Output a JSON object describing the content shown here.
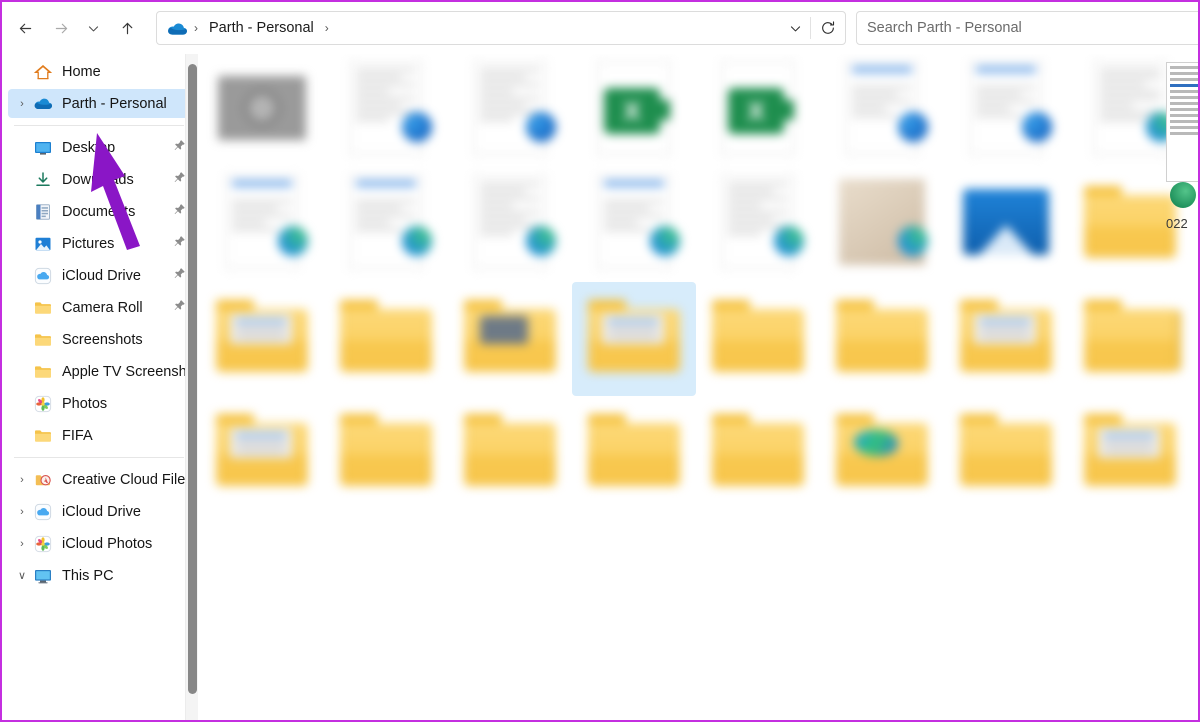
{
  "window": {
    "border_color": "#c42fe0"
  },
  "toolbar": {
    "back_icon": "arrow-left-icon",
    "forward_icon": "arrow-right-icon",
    "recent_icon": "chevron-down-icon",
    "up_icon": "arrow-up-icon",
    "address": {
      "cloud_icon": "onedrive-cloud-icon",
      "crumb_label": "Parth - Personal",
      "sep1": "›",
      "sep2": "›",
      "chevron_icon": "chevron-down-icon"
    },
    "refresh_icon": "refresh-icon",
    "search": {
      "placeholder": "Search Parth - Personal",
      "value": "",
      "icon": "search-icon"
    }
  },
  "sidebar": {
    "items": [
      {
        "label": "Home",
        "icon": "home-icon",
        "chevron": "",
        "pinned": false,
        "selected": false,
        "indent": false
      },
      {
        "label": "Parth - Personal",
        "icon": "onedrive-cloud-icon",
        "chevron": "›",
        "pinned": false,
        "selected": true,
        "indent": false
      },
      {
        "label": "Desktop",
        "icon": "desktop-icon",
        "chevron": "",
        "pinned": true,
        "selected": false,
        "indent": true
      },
      {
        "label": "Downloads",
        "icon": "downloads-icon",
        "chevron": "",
        "pinned": true,
        "selected": false,
        "indent": true
      },
      {
        "label": "Documents",
        "icon": "documents-icon",
        "chevron": "",
        "pinned": true,
        "selected": false,
        "indent": true
      },
      {
        "label": "Pictures",
        "icon": "pictures-icon",
        "chevron": "",
        "pinned": true,
        "selected": false,
        "indent": true
      },
      {
        "label": "iCloud Drive",
        "icon": "icloud-drive-icon",
        "chevron": "",
        "pinned": true,
        "selected": false,
        "indent": true
      },
      {
        "label": "Camera Roll",
        "icon": "folder-icon",
        "chevron": "",
        "pinned": true,
        "selected": false,
        "indent": true
      },
      {
        "label": "Screenshots",
        "icon": "folder-icon",
        "chevron": "",
        "pinned": false,
        "selected": false,
        "indent": true
      },
      {
        "label": "Apple TV Screenshots",
        "icon": "folder-icon",
        "chevron": "",
        "pinned": false,
        "selected": false,
        "indent": true
      },
      {
        "label": "Photos",
        "icon": "photos-icon",
        "chevron": "",
        "pinned": false,
        "selected": false,
        "indent": true
      },
      {
        "label": "FIFA",
        "icon": "folder-icon",
        "chevron": "",
        "pinned": false,
        "selected": false,
        "indent": true
      },
      {
        "label": "Creative Cloud Files",
        "icon": "creative-cloud-icon",
        "chevron": "›",
        "pinned": false,
        "selected": false,
        "indent": false
      },
      {
        "label": "iCloud Drive",
        "icon": "icloud-drive-icon",
        "chevron": "›",
        "pinned": false,
        "selected": false,
        "indent": false
      },
      {
        "label": "iCloud Photos",
        "icon": "photos-icon",
        "chevron": "›",
        "pinned": false,
        "selected": false,
        "indent": false
      },
      {
        "label": "This PC",
        "icon": "this-pc-icon",
        "chevron": "∨",
        "pinned": false,
        "selected": false,
        "indent": false
      }
    ]
  },
  "content": {
    "edge_sliver_text": "022",
    "tiles": [
      {
        "name": "tile-1",
        "kind": "image-thumb",
        "label": "",
        "selected": false,
        "badge": "sync"
      },
      {
        "name": "tile-2",
        "kind": "doc",
        "label": "",
        "selected": false,
        "badge": "cloud"
      },
      {
        "name": "tile-3",
        "kind": "doc",
        "label": "",
        "selected": false,
        "badge": "cloud"
      },
      {
        "name": "tile-4",
        "kind": "xlsx",
        "label": "",
        "selected": false,
        "badge": "none"
      },
      {
        "name": "tile-5",
        "kind": "xlsx",
        "label": "",
        "selected": false,
        "badge": "none"
      },
      {
        "name": "tile-6",
        "kind": "doc-blue",
        "label": "",
        "selected": false,
        "badge": "cloud"
      },
      {
        "name": "tile-7",
        "kind": "doc-blue",
        "label": "",
        "selected": false,
        "badge": "cloud"
      },
      {
        "name": "tile-8",
        "kind": "doc-sheet",
        "label": "",
        "selected": false,
        "badge": "cloud-green"
      },
      {
        "name": "tile-9",
        "kind": "doc-blue",
        "label": "",
        "selected": false,
        "badge": "cloud-green"
      },
      {
        "name": "tile-10",
        "kind": "doc-blue",
        "label": "",
        "selected": false,
        "badge": "cloud-green"
      },
      {
        "name": "tile-11",
        "kind": "doc",
        "label": "",
        "selected": false,
        "badge": "cloud-green"
      },
      {
        "name": "tile-12",
        "kind": "doc-blue",
        "label": "",
        "selected": false,
        "badge": "cloud-green"
      },
      {
        "name": "tile-13",
        "kind": "doc",
        "label": "",
        "selected": false,
        "badge": "cloud-green"
      },
      {
        "name": "tile-14",
        "kind": "photo",
        "label": "",
        "selected": false,
        "badge": "cloud-green"
      },
      {
        "name": "tile-15",
        "kind": "blue-picture",
        "label": "",
        "selected": false,
        "badge": "none"
      },
      {
        "name": "tile-16",
        "kind": "folder",
        "label": "",
        "selected": false,
        "badge": "none"
      },
      {
        "name": "tile-17",
        "kind": "folder-doc",
        "label": "",
        "selected": false,
        "badge": "none"
      },
      {
        "name": "tile-18",
        "kind": "folder",
        "label": "",
        "selected": false,
        "badge": "none"
      },
      {
        "name": "tile-19",
        "kind": "folder-dark",
        "label": "",
        "selected": false,
        "badge": "none"
      },
      {
        "name": "tile-20",
        "kind": "folder-doc",
        "label": "",
        "selected": true,
        "badge": "none"
      },
      {
        "name": "tile-21",
        "kind": "folder",
        "label": "",
        "selected": false,
        "badge": "dark-dot"
      },
      {
        "name": "tile-22",
        "kind": "folder",
        "label": "",
        "selected": false,
        "badge": "none"
      },
      {
        "name": "tile-23",
        "kind": "folder-doc",
        "label": "",
        "selected": false,
        "badge": "none"
      },
      {
        "name": "tile-24",
        "kind": "folder-peek",
        "label": "",
        "selected": false,
        "badge": "none"
      },
      {
        "name": "tile-25",
        "kind": "folder-doc",
        "label": "",
        "selected": false,
        "badge": "none"
      },
      {
        "name": "tile-26",
        "kind": "folder",
        "label": "",
        "selected": false,
        "badge": "none"
      },
      {
        "name": "tile-27",
        "kind": "folder",
        "label": "",
        "selected": false,
        "badge": "none"
      },
      {
        "name": "tile-28",
        "kind": "folder",
        "label": "",
        "selected": false,
        "badge": "none"
      },
      {
        "name": "tile-29",
        "kind": "folder",
        "label": "",
        "selected": false,
        "badge": "none"
      },
      {
        "name": "tile-30",
        "kind": "folder-blob",
        "label": "",
        "selected": false,
        "badge": "none"
      },
      {
        "name": "tile-31",
        "kind": "folder",
        "label": "",
        "selected": false,
        "badge": "none"
      },
      {
        "name": "tile-32",
        "kind": "folder-doc",
        "label": "",
        "selected": false,
        "badge": "none"
      }
    ]
  },
  "annotation": {
    "arrow_color": "#8a16c6",
    "points_at": "Parth - Personal"
  }
}
